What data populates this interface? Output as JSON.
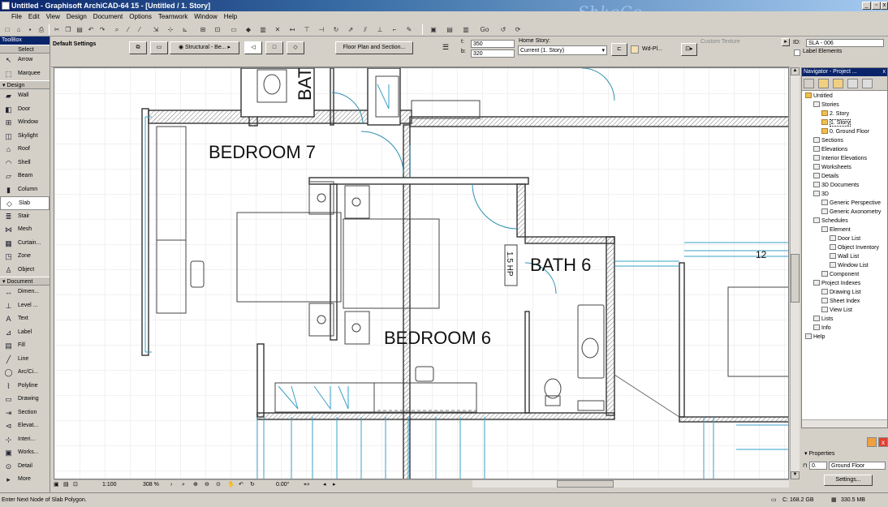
{
  "window": {
    "title": "Untitled - Graphisoft ArchiCAD-64 15 - [Untitled / 1. Story]",
    "watermark": "ShkeCe",
    "min": "_",
    "restore": "▫",
    "close": "x"
  },
  "menu": [
    "File",
    "Edit",
    "View",
    "Design",
    "Document",
    "Options",
    "Teamwork",
    "Window",
    "Help"
  ],
  "toolbar": {
    "go_label": "Go"
  },
  "toolbox": {
    "title": "ToolBox",
    "select_label": "Select",
    "select_tools": [
      {
        "label": "Arrow",
        "icon": "arrow-icon"
      },
      {
        "label": "Marquee",
        "icon": "marquee-icon"
      }
    ],
    "design_header": "Design",
    "design_tools": [
      {
        "label": "Wall",
        "icon": "wall-icon"
      },
      {
        "label": "Door",
        "icon": "door-icon"
      },
      {
        "label": "Window",
        "icon": "window-icon"
      },
      {
        "label": "Skylight",
        "icon": "skylight-icon"
      },
      {
        "label": "Roof",
        "icon": "roof-icon"
      },
      {
        "label": "Shell",
        "icon": "shell-icon"
      },
      {
        "label": "Beam",
        "icon": "beam-icon"
      },
      {
        "label": "Column",
        "icon": "column-icon"
      },
      {
        "label": "Slab",
        "icon": "slab-icon",
        "selected": true
      },
      {
        "label": "Stair",
        "icon": "stair-icon"
      },
      {
        "label": "Mesh",
        "icon": "mesh-icon"
      },
      {
        "label": "Curtain...",
        "icon": "curtain-wall-icon"
      },
      {
        "label": "Zone",
        "icon": "zone-icon"
      },
      {
        "label": "Object",
        "icon": "object-icon"
      }
    ],
    "document_header": "Document",
    "document_tools": [
      {
        "label": "Dimen...",
        "icon": "dimension-icon"
      },
      {
        "label": "Level ...",
        "icon": "level-icon"
      },
      {
        "label": "Text",
        "icon": "text-icon"
      },
      {
        "label": "Label",
        "icon": "label-icon"
      },
      {
        "label": "Fill",
        "icon": "fill-icon"
      },
      {
        "label": "Line",
        "icon": "line-icon"
      },
      {
        "label": "Arc/Ci...",
        "icon": "arc-icon"
      },
      {
        "label": "Polyline",
        "icon": "polyline-icon"
      },
      {
        "label": "Drawing",
        "icon": "drawing-icon"
      },
      {
        "label": "Section",
        "icon": "section-icon"
      },
      {
        "label": "Elevat...",
        "icon": "elevation-icon"
      },
      {
        "label": "Interi...",
        "icon": "interior-icon"
      },
      {
        "label": "Works...",
        "icon": "worksheet-icon"
      },
      {
        "label": "Detail",
        "icon": "detail-icon"
      }
    ],
    "more_label": "More"
  },
  "infobox": {
    "default_settings": "Default Settings",
    "structural": "Structural - Be...",
    "plan_section": "Floor Plan and Section...",
    "field_t": "350",
    "field_b": "320",
    "label_t": "t:",
    "label_b": "b:",
    "home_story_label": "Home Story:",
    "home_story_value": "Current (1. Story)",
    "wd_label": "Wd-Pl...",
    "custom_texture": "Custom Texture",
    "id_label": "ID:",
    "id_value": "SLA - 006",
    "label_elements": "Label Elements"
  },
  "plan": {
    "rooms": [
      "BEDROOM 7",
      "BEDROOM 6",
      "BATH 6",
      "BATH"
    ],
    "hp_text": "1.5 HP",
    "number": "12"
  },
  "bottom": {
    "scale": "1:100",
    "zoom": "308 %",
    "angle": "0.00°"
  },
  "status": {
    "prompt": "Enter Next Node of Slab Polygon.",
    "disk": "C: 168.2 GB",
    "mem": "330.5 MB"
  },
  "navigator": {
    "title": "Navigator - Project ...",
    "tree": [
      {
        "label": "Untitled",
        "d": 0,
        "icon": "house-icon"
      },
      {
        "label": "Stories",
        "d": 1,
        "icon": "stories-icon"
      },
      {
        "label": "2. Story",
        "d": 2,
        "icon": "story-icon"
      },
      {
        "label": "1. Story",
        "d": 2,
        "icon": "story-icon",
        "selected": true
      },
      {
        "label": "0. Ground Floor",
        "d": 2,
        "icon": "story-icon"
      },
      {
        "label": "Sections",
        "d": 1,
        "icon": "sections-icon"
      },
      {
        "label": "Elevations",
        "d": 1,
        "icon": "elevations-icon"
      },
      {
        "label": "Interior Elevations",
        "d": 1,
        "icon": "interior-elevations-icon"
      },
      {
        "label": "Worksheets",
        "d": 1,
        "icon": "worksheets-icon"
      },
      {
        "label": "Details",
        "d": 1,
        "icon": "details-icon"
      },
      {
        "label": "3D Documents",
        "d": 1,
        "icon": "3d-documents-icon"
      },
      {
        "label": "3D",
        "d": 1,
        "icon": "3d-icon"
      },
      {
        "label": "Generic Perspective",
        "d": 2,
        "icon": "perspective-icon"
      },
      {
        "label": "Generic Axonometry",
        "d": 2,
        "icon": "axonometry-icon"
      },
      {
        "label": "Schedules",
        "d": 1,
        "icon": "schedules-icon"
      },
      {
        "label": "Element",
        "d": 2,
        "icon": "element-icon"
      },
      {
        "label": "Door List",
        "d": 3,
        "icon": "list-icon"
      },
      {
        "label": "Object Inventory",
        "d": 3,
        "icon": "list-icon"
      },
      {
        "label": "Wall List",
        "d": 3,
        "icon": "list-icon"
      },
      {
        "label": "Window List",
        "d": 3,
        "icon": "list-icon"
      },
      {
        "label": "Component",
        "d": 2,
        "icon": "component-icon"
      },
      {
        "label": "Project Indexes",
        "d": 1,
        "icon": "indexes-icon"
      },
      {
        "label": "Drawing List",
        "d": 2,
        "icon": "list-icon"
      },
      {
        "label": "Sheet Index",
        "d": 2,
        "icon": "list-icon"
      },
      {
        "label": "View List",
        "d": 2,
        "icon": "list-icon"
      },
      {
        "label": "Lists",
        "d": 1,
        "icon": "lists-icon"
      },
      {
        "label": "Info",
        "d": 1,
        "icon": "info-icon"
      },
      {
        "label": "Help",
        "d": 0,
        "icon": "help-icon"
      }
    ]
  },
  "properties": {
    "title": "Properties",
    "field": "0.",
    "value": "Ground Floor",
    "settings": "Settings..."
  }
}
